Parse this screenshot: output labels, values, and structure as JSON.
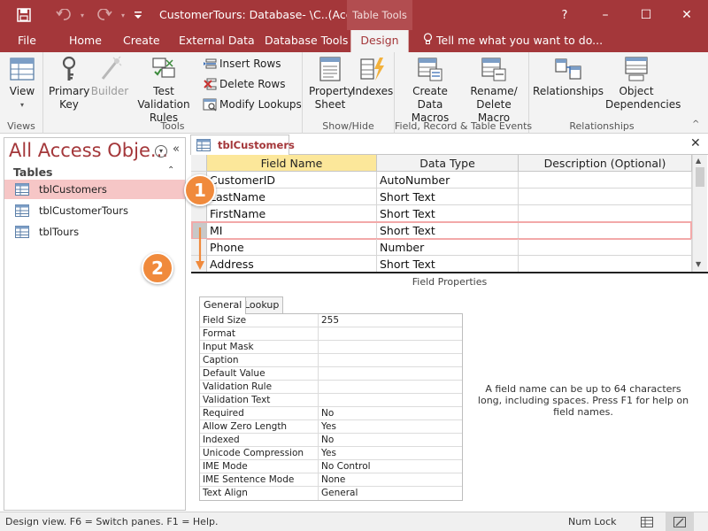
{
  "window": {
    "title": "CustomerTours: Database- \\C..(Acces...",
    "context_tab": "Table Tools",
    "help_glyph": "?",
    "minimize_glyph": "–",
    "maximize_glyph": "☐",
    "close_glyph": "✕"
  },
  "tabs": {
    "file": "File",
    "home": "Home",
    "create": "Create",
    "external": "External Data",
    "tools": "Database Tools",
    "design": "Design",
    "tellme": "Tell me what you want to do..."
  },
  "ribbon": {
    "views": {
      "view": "View",
      "label": "Views"
    },
    "tools": {
      "primary_key": "Primary Key",
      "builder": "Builder",
      "test_validation": "Test Validation Rules",
      "insert_rows": "Insert Rows",
      "delete_rows": "Delete Rows",
      "modify_lookups": "Modify Lookups",
      "label": "Tools"
    },
    "showhide": {
      "property_sheet": "Property Sheet",
      "indexes": "Indexes",
      "label": "Show/Hide"
    },
    "events": {
      "create_macros": "Create Data Macros",
      "rename_delete": "Rename/ Delete Macro",
      "label": "Field, Record & Table Events"
    },
    "relationships": {
      "relationships": "Relationships",
      "object_dependencies": "Object Dependencies",
      "label": "Relationships"
    }
  },
  "nav": {
    "title": "All Access Obje...",
    "section": "Tables",
    "items": [
      "tblCustomers",
      "tblCustomerTours",
      "tblTours"
    ]
  },
  "doc": {
    "tab": "tblCustomers",
    "close": "✕"
  },
  "grid": {
    "headers": [
      "Field Name",
      "Data Type",
      "Description (Optional)"
    ],
    "rows": [
      {
        "name": "CustomerID",
        "type": "AutoNumber",
        "desc": ""
      },
      {
        "name": "LastName",
        "type": "Short Text",
        "desc": ""
      },
      {
        "name": "FirstName",
        "type": "Short Text",
        "desc": ""
      },
      {
        "name": "MI",
        "type": "Short Text",
        "desc": ""
      },
      {
        "name": "Phone",
        "type": "Number",
        "desc": ""
      },
      {
        "name": "Address",
        "type": "Short Text",
        "desc": ""
      }
    ]
  },
  "field_properties": {
    "label": "Field Properties",
    "tabs": [
      "General",
      "Lookup"
    ],
    "rows": [
      {
        "name": "Field Size",
        "value": "255"
      },
      {
        "name": "Format",
        "value": ""
      },
      {
        "name": "Input Mask",
        "value": ""
      },
      {
        "name": "Caption",
        "value": ""
      },
      {
        "name": "Default Value",
        "value": ""
      },
      {
        "name": "Validation Rule",
        "value": ""
      },
      {
        "name": "Validation Text",
        "value": ""
      },
      {
        "name": "Required",
        "value": "No"
      },
      {
        "name": "Allow Zero Length",
        "value": "Yes"
      },
      {
        "name": "Indexed",
        "value": "No"
      },
      {
        "name": "Unicode Compression",
        "value": "Yes"
      },
      {
        "name": "IME Mode",
        "value": "No Control"
      },
      {
        "name": "IME Sentence Mode",
        "value": "None"
      },
      {
        "name": "Text Align",
        "value": "General"
      }
    ],
    "help": "A field name can be up to 64 characters long, including spaces. Press F1 for help on field names."
  },
  "status": {
    "text": "Design view.  F6 = Switch panes.  F1 = Help.",
    "numlock": "Num Lock"
  },
  "callouts": [
    "1",
    "2"
  ],
  "colors": {
    "accent": "#a4373a",
    "callout": "#f08a3c",
    "selected_nav": "#f6c6c6"
  },
  "icons": [
    "save-icon",
    "undo-icon",
    "redo-icon",
    "view-icon",
    "key-icon",
    "builder-icon",
    "validation-icon",
    "insert-rows-icon",
    "delete-rows-icon",
    "modify-lookups-icon",
    "property-sheet-icon",
    "indexes-icon",
    "macros-icon",
    "rename-macro-icon",
    "relationships-icon",
    "dependencies-icon",
    "table-icon",
    "lightbulb-icon"
  ]
}
